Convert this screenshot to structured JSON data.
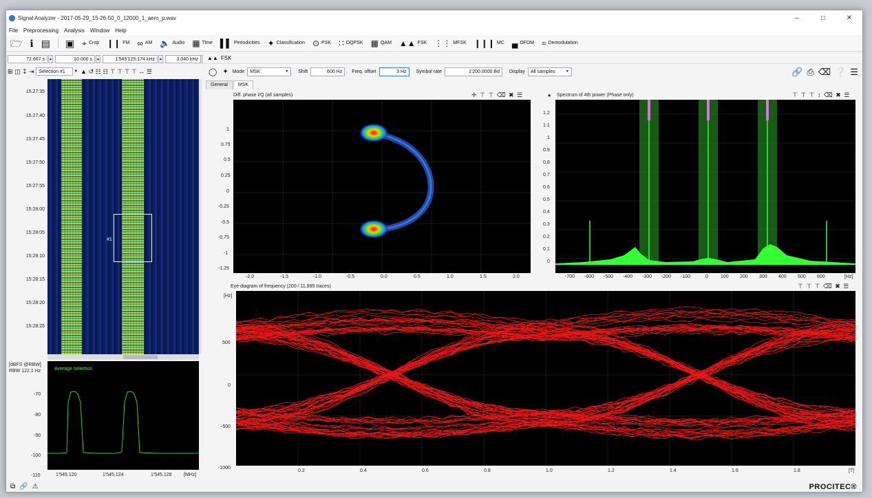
{
  "window": {
    "title": "Signal Analyzer - 2017-05-29_15-26-50_0_12000_1_aero_p.wav"
  },
  "menu": [
    "File",
    "Preprocessing",
    "Analysis",
    "Window",
    "Help"
  ],
  "toolbar": {
    "crop": "Crop",
    "fm": "FM",
    "am": "AM",
    "audio": "Audio",
    "time": "Time",
    "periodicities": "Periodicities",
    "classification": "Classification",
    "psk": "PSK",
    "oqpsk": "OQPSK",
    "qam": "QAM",
    "fsk": "FSK",
    "mfsk": "MFSK",
    "mc": "MC",
    "ofdm": "OFDM",
    "demodulation": "Demodulation"
  },
  "left": {
    "time_start": "72.667 s",
    "time_span": "10.000 s",
    "freq_center": "1'545'125.174 kHz",
    "freq_span": "3.040 kHz",
    "selection": "Selection #1",
    "time_ticks": [
      "15:27:35",
      "15:27:40",
      "15:27:45",
      "15:27:50",
      "15:27:55",
      "15:28:00",
      "15:28:05",
      "15:28:10",
      "15:28:15",
      "15:28:20",
      "15:28:25"
    ],
    "selection_label": "#1",
    "spectrum": {
      "unit": "[dBFS @RBW]",
      "rbw": "RBW 122.1 Hz",
      "legend": "Average selection",
      "y_ticks": [
        "-70",
        "-80",
        "-90",
        "-100",
        "-110"
      ],
      "x_ticks": [
        "1'545.120",
        "1'545.124",
        "1'545.128"
      ],
      "x_unit": "[MHz]"
    }
  },
  "fsk": {
    "header": "FSK",
    "mode_label": "Mode",
    "mode_value": "MSK",
    "shift_label": "Shift",
    "shift_value": "600 Hz",
    "freq_offset_label": "Freq. offset",
    "freq_offset_value": "3 Hz",
    "symbol_rate_label": "Symbol rate",
    "symbol_rate_value": "1'200.0000 Bd",
    "display_label": "Display",
    "display_value": "All samples",
    "tabs": [
      "General",
      "MSK"
    ]
  },
  "iq": {
    "title": "Diff. phase I/Q (all samples)",
    "y_ticks": [
      "1",
      "0.75",
      "0.5",
      "0.25",
      "0",
      "-0.25",
      "-0.5",
      "-0.75",
      "-1",
      "-1.25"
    ],
    "x_ticks": [
      "-2.0",
      "-1.5",
      "-1.0",
      "-0.5",
      "0.0",
      "0.5",
      "1.0",
      "1.5",
      "2.0"
    ]
  },
  "spec4": {
    "title": "Spectrum of 4th power (Phase only)",
    "y_ticks": [
      "1.2",
      "1.1",
      "1",
      "0.9",
      "0.8",
      "0.7",
      "0.6",
      "0.5",
      "0.4",
      "0.3",
      "0.2",
      "0.1",
      "0"
    ],
    "x_ticks": [
      "-700",
      "-600",
      "-500",
      "-400",
      "-300",
      "-200",
      "-100",
      "0",
      "100",
      "200",
      "300",
      "400",
      "500",
      "600"
    ],
    "x_unit": "[Hz]"
  },
  "eye": {
    "title": "Eye diagram of frequency (200 / 11,995 traces)",
    "y_unit": "[Hz]",
    "y_ticks": [
      "500",
      "0",
      "-500",
      "-1000"
    ],
    "x_ticks": [
      "0.2",
      "0.4",
      "0.6",
      "0.8",
      "1.0",
      "1.2",
      "1.4",
      "1.6",
      "1.8"
    ],
    "x_unit": "[T]"
  },
  "brand": "PROCITEC®",
  "colors": {
    "trace_red": "#ff1a1a",
    "spec_green": "#33ff33",
    "accent_blue": "#2a7fd8"
  }
}
